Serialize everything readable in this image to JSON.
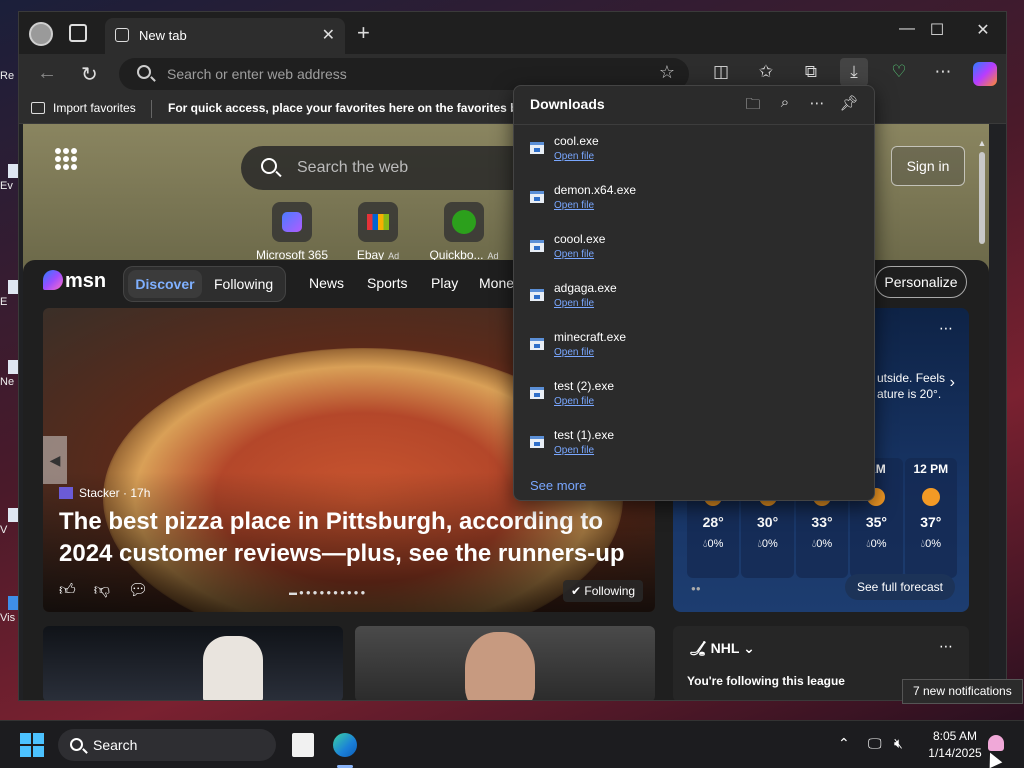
{
  "desktop": {
    "icons": [
      "Re",
      "Ev",
      "E",
      "Ne",
      "V",
      "Vis"
    ]
  },
  "browser": {
    "tab": {
      "title": "New tab"
    },
    "address": {
      "placeholder": "Search or enter web address"
    },
    "favorites_bar": {
      "import_label": "Import favorites",
      "hint": "For quick access, place your favorites here on the favorites bar."
    }
  },
  "newtab": {
    "search_placeholder": "Search the web",
    "sign_in": "Sign in",
    "quick_links": [
      {
        "label": "Microsoft 365",
        "ad": ""
      },
      {
        "label": "Ebay",
        "ad": "Ad"
      },
      {
        "label": "Quickbo...",
        "ad": "Ad"
      }
    ]
  },
  "msn": {
    "logo": "msn",
    "tabs": {
      "discover": "Discover",
      "following": "Following"
    },
    "nav": [
      "News",
      "Sports",
      "Play",
      "Mone"
    ],
    "personalize": "Personalize",
    "hero": {
      "source": "Stacker",
      "age": "· 17h",
      "headline": "The best pizza place in Pittsburgh, according to 2024 customer reviews—plus, see the runners-up",
      "following": "Following"
    },
    "weather": {
      "description_line1": "utside. Feels",
      "description_line2": "ature is 20°.",
      "hours": [
        {
          "time": "",
          "temp": "28°",
          "precip": "0%"
        },
        {
          "time": "",
          "temp": "30°",
          "precip": "0%"
        },
        {
          "time": "",
          "temp": "33°",
          "precip": "0%"
        },
        {
          "time": "AM",
          "temp": "35°",
          "precip": "0%"
        },
        {
          "time": "12 PM",
          "temp": "37°",
          "precip": "0%"
        }
      ],
      "full_forecast": "See full forecast"
    },
    "nhl_card": {
      "league": "NHL",
      "following_text": "You're following this league"
    }
  },
  "downloads": {
    "title": "Downloads",
    "open_label": "Open file",
    "items": [
      "cool.exe",
      "demon.x64.exe",
      "coool.exe",
      "adgaga.exe",
      "minecraft.exe",
      "test (2).exe",
      "test (1).exe"
    ],
    "see_more": "See more"
  },
  "taskbar": {
    "search_label": "Search",
    "time": "8:05 AM",
    "date": "1/14/2025",
    "notification_toast": "7 new notifications"
  },
  "colors": {
    "accent_link": "#79a7ff",
    "windows_blue": "#4cc2ff"
  }
}
